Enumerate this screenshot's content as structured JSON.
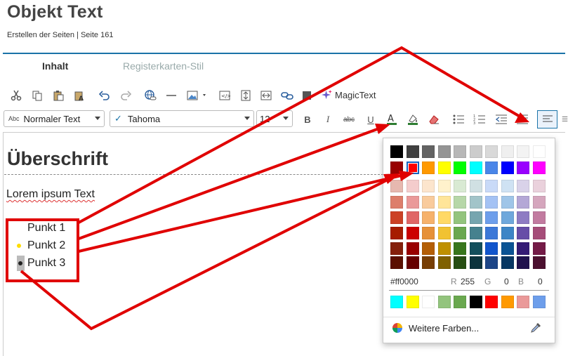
{
  "header": {
    "title": "Objekt Text",
    "subtitle": "Erstellen der Seiten | Seite 161"
  },
  "tabs": [
    {
      "label": "Inhalt",
      "active": true
    },
    {
      "label": "Registerkarten-Stil",
      "active": false
    }
  ],
  "toolbar": {
    "magictext_label": "MagicText"
  },
  "format": {
    "style_value": "Normaler Text",
    "style_prefix": "Abc",
    "font_value": "Tahoma",
    "size_value": "12"
  },
  "editor": {
    "heading": "Überschrift",
    "paragraph": "Lorem ipsum Text",
    "list": [
      "Punkt 1",
      "Punkt 2",
      "Punkt 3"
    ]
  },
  "color_popup": {
    "grid": [
      [
        "#000000",
        "#404040",
        "#636363",
        "#949494",
        "#b7b7b7",
        "#cccccc",
        "#d9d9d9",
        "#efefef",
        "#f3f3f3",
        "#ffffff"
      ],
      [
        "#980000",
        "#ff0000",
        "#ff9900",
        "#ffff00",
        "#00ff00",
        "#00ffff",
        "#4a86e8",
        "#0000ff",
        "#9900ff",
        "#ff00ff"
      ],
      [
        "#e6b8af",
        "#f4cccc",
        "#fce5cd",
        "#fff2cc",
        "#d9ead3",
        "#d0e0e3",
        "#c9daf8",
        "#cfe2f3",
        "#d9d2e9",
        "#ead1dc"
      ],
      [
        "#dd7e6b",
        "#ea9999",
        "#f9cb9c",
        "#ffe599",
        "#b6d7a8",
        "#a2c4c9",
        "#a4c2f4",
        "#9fc5e8",
        "#b4a7d6",
        "#d5a6bd"
      ],
      [
        "#cc4125",
        "#e06666",
        "#f6b26b",
        "#ffd966",
        "#93c47d",
        "#76a5af",
        "#6d9eeb",
        "#6fa8dc",
        "#8e7cc3",
        "#c27ba0"
      ],
      [
        "#a61c00",
        "#cc0000",
        "#e69138",
        "#f1c232",
        "#6aa84f",
        "#45818e",
        "#3c78d8",
        "#3d85c6",
        "#674ea7",
        "#a64d79"
      ],
      [
        "#85200c",
        "#990000",
        "#b45f06",
        "#bf9000",
        "#38761d",
        "#134f5c",
        "#1155cc",
        "#0b5394",
        "#351c75",
        "#741b47"
      ],
      [
        "#5b0f00",
        "#660000",
        "#783f04",
        "#7f6000",
        "#274e13",
        "#0c343d",
        "#1c4587",
        "#073763",
        "#20124d",
        "#4c1130"
      ]
    ],
    "selected": "#ff0000",
    "hex_value": "#ff0000",
    "r_label": "R",
    "r_value": "255",
    "g_label": "G",
    "g_value": "0",
    "b_label": "B",
    "b_value": "0",
    "recent": [
      "#00ffff",
      "#ffff00",
      "#ffffff",
      "#93c47d",
      "#6aa84f",
      "#000000",
      "#ff0000",
      "#ff9900",
      "#ea9999",
      "#6d9eeb"
    ],
    "more_colors_label": "Weitere Farben..."
  },
  "colors": {
    "accent": "#1a73a8",
    "annotation": "#e00000"
  }
}
